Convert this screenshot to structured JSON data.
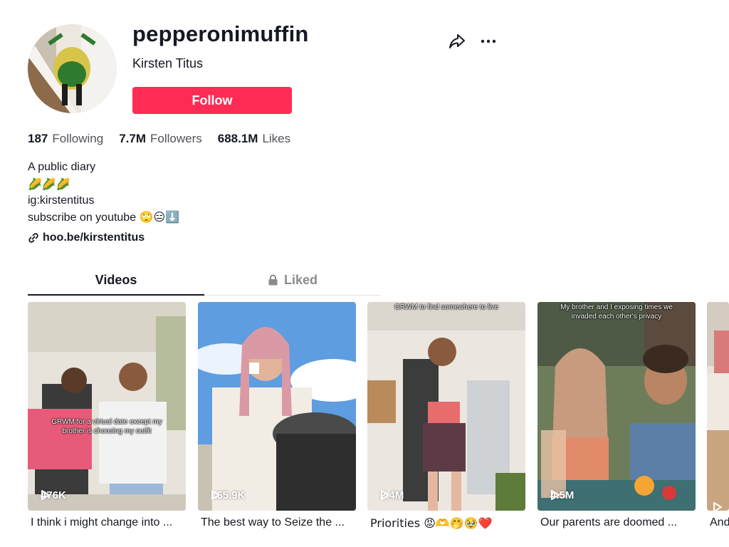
{
  "profile": {
    "username": "pepperonimuffin",
    "display_name": "Kirsten Titus",
    "follow_label": "Follow"
  },
  "counts": [
    {
      "value": "187",
      "label": "Following"
    },
    {
      "value": "7.7M",
      "label": "Followers"
    },
    {
      "value": "688.1M",
      "label": "Likes"
    }
  ],
  "bio": {
    "lines": [
      "A public diary",
      "🌽🌽🌽",
      "ig:kirstentitus",
      "subscribe on youtube 🙄😑⬇️"
    ],
    "link": "hoo.be/kirstentitus"
  },
  "tabs": {
    "videos": "Videos",
    "liked": "Liked"
  },
  "videos": [
    {
      "views": "476K",
      "caption": "I think i might change into ...",
      "overlay": "GRWM for a virtual date except my brother is choosing my outfit"
    },
    {
      "views": "165.9K",
      "caption": "The best way to Seize the ...",
      "overlay": ""
    },
    {
      "views": "2.4M",
      "caption": "Priorities 😡🫶🤭🥹❤️",
      "overlay": "GRWM to find somewhere to live"
    },
    {
      "views": "4.5M",
      "caption": "Our parents are doomed ...",
      "overlay": "My brother and I exposing times we invaded each other's privacy"
    },
    {
      "views": "",
      "caption": "And",
      "overlay": ""
    }
  ],
  "icons": {
    "share": "share-arrow-icon",
    "more": "more-dots-icon",
    "link": "link-icon",
    "lock": "lock-icon",
    "play": "play-icon"
  },
  "colors": {
    "accent": "#fe2c55",
    "text": "#161823",
    "muted": "#525259"
  }
}
